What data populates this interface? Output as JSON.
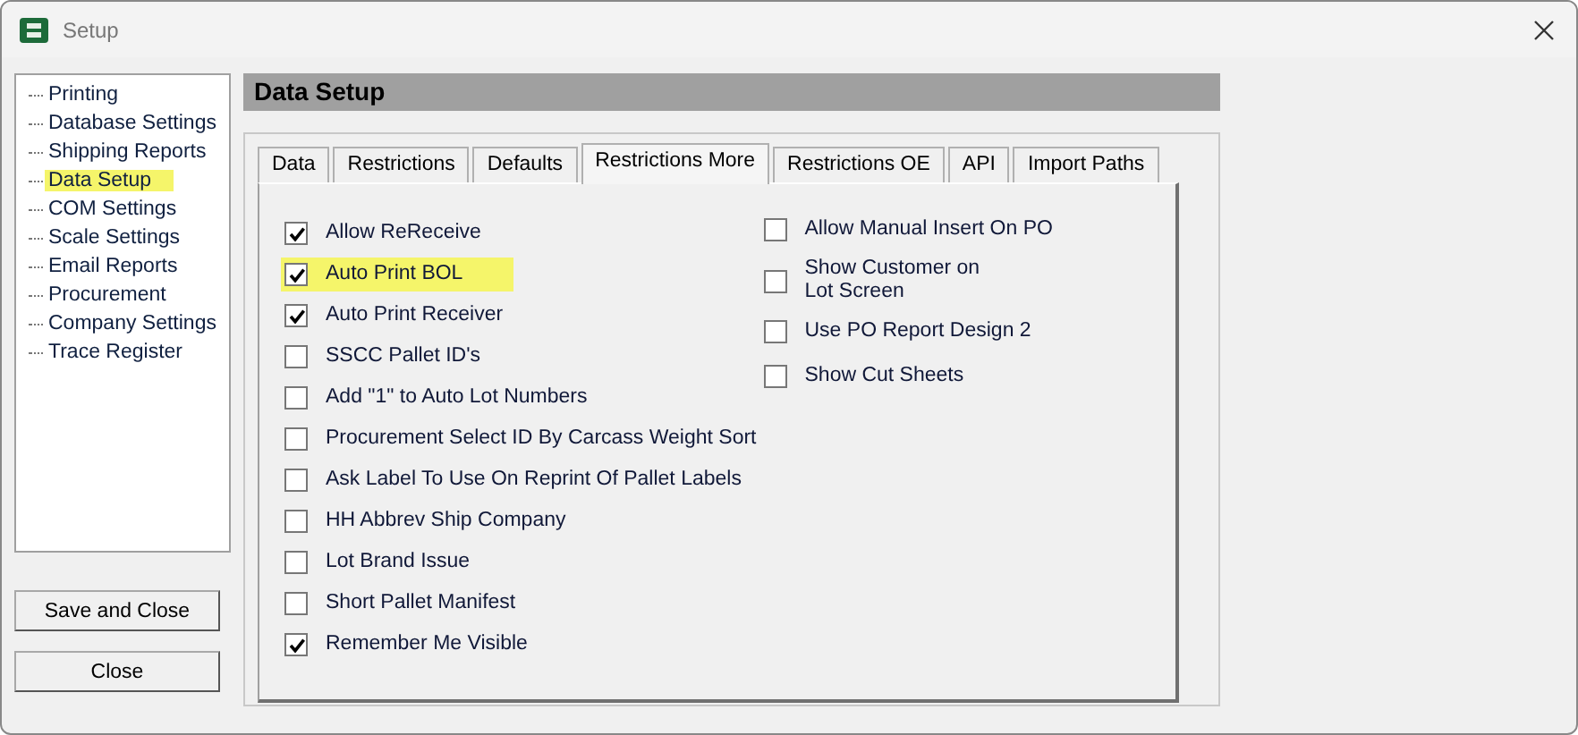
{
  "window": {
    "title": "Setup"
  },
  "sidebar": {
    "items": [
      {
        "label": "Printing",
        "selected": false
      },
      {
        "label": "Database Settings",
        "selected": false
      },
      {
        "label": "Shipping Reports",
        "selected": false
      },
      {
        "label": "Data Setup",
        "selected": true
      },
      {
        "label": "COM Settings",
        "selected": false
      },
      {
        "label": "Scale Settings",
        "selected": false
      },
      {
        "label": "Email Reports",
        "selected": false
      },
      {
        "label": "Procurement",
        "selected": false
      },
      {
        "label": "Company Settings",
        "selected": false
      },
      {
        "label": "Trace Register",
        "selected": false
      }
    ]
  },
  "buttons": [
    "Save and Close",
    "Close"
  ],
  "header": "Data Setup",
  "tabs": [
    {
      "label": "Data",
      "selected": false
    },
    {
      "label": "Restrictions",
      "selected": false
    },
    {
      "label": "Defaults",
      "selected": false
    },
    {
      "label": "Restrictions More",
      "selected": true
    },
    {
      "label": "Restrictions OE",
      "selected": false
    },
    {
      "label": "API",
      "selected": false
    },
    {
      "label": "Import Paths",
      "selected": false
    }
  ],
  "left_options": [
    {
      "label": "Allow ReReceive",
      "checked": true,
      "highlighted": false
    },
    {
      "label": "Auto Print BOL",
      "checked": true,
      "highlighted": true
    },
    {
      "label": "Auto Print Receiver",
      "checked": true,
      "highlighted": false
    },
    {
      "label": "SSCC Pallet ID's",
      "checked": false,
      "highlighted": false
    },
    {
      "label": "Add \"1\" to Auto Lot Numbers",
      "checked": false,
      "highlighted": false
    },
    {
      "label": "Procurement Select ID By Carcass Weight Sort",
      "checked": false,
      "highlighted": false
    },
    {
      "label": "Ask Label To Use On Reprint Of Pallet Labels",
      "checked": false,
      "highlighted": false
    },
    {
      "label": "HH Abbrev Ship Company",
      "checked": false,
      "highlighted": false
    },
    {
      "label": "Lot Brand Issue",
      "checked": false,
      "highlighted": false
    },
    {
      "label": "Short Pallet Manifest",
      "checked": false,
      "highlighted": false
    },
    {
      "label": "Remember Me Visible",
      "checked": true,
      "highlighted": false
    }
  ],
  "right_options": [
    {
      "label": "Allow Manual Insert On PO",
      "checked": false,
      "highlighted": false
    },
    {
      "label": "Show Customer on\nLot Screen",
      "checked": false,
      "highlighted": false
    },
    {
      "label": "Use PO Report Design 2",
      "checked": false,
      "highlighted": false
    },
    {
      "label": "Show Cut Sheets",
      "checked": false,
      "highlighted": false
    }
  ]
}
